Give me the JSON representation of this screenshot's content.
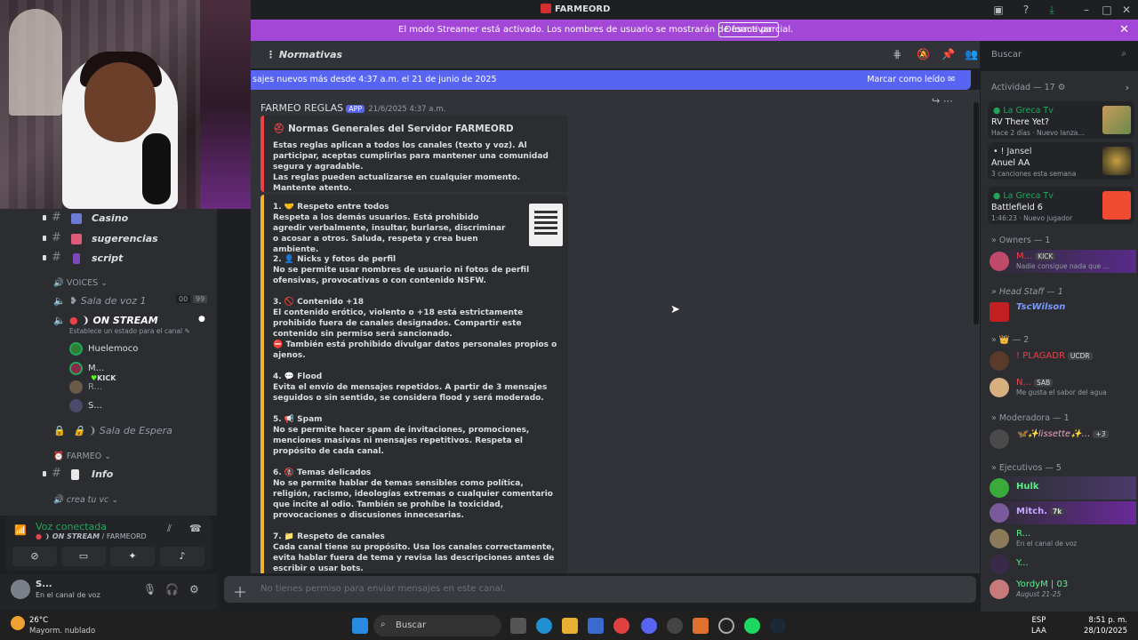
{
  "window": {
    "title": "FARMEORD"
  },
  "banner": {
    "message": "El modo Streamer está activado. Los nombres de usuario se mostrarán de forma parcial.",
    "button": "Desactivar"
  },
  "sidebar": {
    "channels": [
      {
        "name": "Casino"
      },
      {
        "name": "sugerencias"
      },
      {
        "name": "script"
      }
    ],
    "voices_category": "VOICES",
    "voice_channels": [
      {
        "name": "Sala de voz 1",
        "count_left": "00",
        "count_right": "99"
      },
      {
        "name": "ON STREAM",
        "status_hint": "Establece un estado para el canal"
      }
    ],
    "voice_users": [
      {
        "name": "Huelemoco"
      },
      {
        "name": "M...",
        "badge": "KICK"
      },
      {
        "name": "R..."
      },
      {
        "name": "S..."
      }
    ],
    "waiting_room": "Sala de Espera",
    "farmeo_category": "FARMEO",
    "info_channel": "Info",
    "crea_category": "crea tu vc"
  },
  "voice_panel": {
    "status": "Voz conectada",
    "location_channel": "ON STREAM",
    "location_server": "FARMEORD"
  },
  "user_panel": {
    "name": "S...",
    "status": "En el canal de voz"
  },
  "header": {
    "channel_name": "Normativas",
    "search_placeholder": "Buscar"
  },
  "new_messages": {
    "text": "sajes nuevos más desde 4:37 a.m. el 21 de junio de 2025",
    "action": "Marcar como leído"
  },
  "message": {
    "author": "FARMEO REGLAS",
    "app_tag": "APP",
    "timestamp": "21/6/2025 4:37 a.m.",
    "embed1_title": "Normas Generales del Servidor FARMEORD",
    "embed1_p1": "Estas reglas aplican a todos los canales (texto y voz). Al participar, aceptas cumplirlas para mantener una comunidad segura y agradable.",
    "embed1_p2": "Las reglas pueden actualizarse en cualquier momento. Mantente atento.",
    "rules": [
      {
        "title": "1. 🤝 Respeto entre todos",
        "body": "Respeta a los demás usuarios. Está prohibido agredir verbalmente, insultar, burlarse, discriminar o acosar a otros. Saluda, respeta y crea buen ambiente."
      },
      {
        "title": "2. 👤 Nicks y fotos de perfil",
        "body": "No se permite usar nombres de usuario ni fotos de perfil ofensivas, provocativas o con contenido NSFW."
      },
      {
        "title": "3. 🚫 Contenido +18",
        "body": "El contenido erótico, violento o +18 está estrictamente prohibido fuera de canales designados. Compartir este contenido sin permiso será sancionado.",
        "extra": "⛔ También está prohibido divulgar datos personales propios o ajenos."
      },
      {
        "title": "4. 💬 Flood",
        "body": "Evita el envío de mensajes repetidos. A partir de 3 mensajes seguidos o sin sentido, se considera flood y será moderado."
      },
      {
        "title": "5. 📢 Spam",
        "body": "No se permite hacer spam de invitaciones, promociones, menciones masivas ni mensajes repetitivos. Respeta el propósito de cada canal."
      },
      {
        "title": "6. 🚷 Temas delicados",
        "body": "No se permite hablar de temas sensibles como política, religión, racismo, ideologías extremas o cualquier comentario que incite al odio. También se prohíbe la toxicidad, provocaciones o discusiones innecesarias."
      },
      {
        "title": "7. 📁 Respeto de canales",
        "body": "Cada canal tiene su propósito. Usa los canales correctamente, evita hablar fuera de tema y revisa las descripciones antes de escribir o usar bots."
      }
    ]
  },
  "input": {
    "placeholder": "No tienes permiso para enviar mensajes en este canal."
  },
  "members": {
    "activity_header": "Actividad — 17",
    "activities": [
      {
        "user": "La Greca Tv",
        "title": "RV There Yet?",
        "meta": "Hace 2 días · Nuevo lanza..."
      },
      {
        "user": "! Jansel",
        "title": "Anuel AA",
        "meta": "3 canciones esta semana"
      },
      {
        "user": "La Greca Tv",
        "title": "Battlefield 6",
        "meta": "1:46:23 · Nuevo jugador"
      }
    ],
    "groups": [
      {
        "header": "Owners — 1",
        "members": [
          {
            "name": "M...",
            "tag": "KICK",
            "sub": "Nadie consigue nada que ..."
          }
        ]
      },
      {
        "header": "Head Staff — 1",
        "members": [
          {
            "name": "TscWilson",
            "sub": ""
          }
        ]
      },
      {
        "header": "— 2",
        "members": [
          {
            "name": "! PLAGADR",
            "tag": "UCDR",
            "sub": ""
          },
          {
            "name": "N...",
            "tag": "SAB",
            "sub": "Me gusta el sabor del agua"
          }
        ]
      },
      {
        "header": "Moderadora — 1",
        "members": [
          {
            "name": "lissette",
            "tag": "+3",
            "sub": ""
          }
        ]
      },
      {
        "header": "Ejecutivos — 5",
        "members": [
          {
            "name": "Hulk",
            "sub": ""
          },
          {
            "name": "Mitch.",
            "tag": "7k",
            "sub": ""
          },
          {
            "name": "R...",
            "sub": "En el canal de voz"
          },
          {
            "name": "Y...",
            "sub": ""
          },
          {
            "name": "YordyM | 03",
            "sub": "August 21-25"
          }
        ]
      }
    ]
  },
  "taskbar": {
    "weather_temp": "26°C",
    "weather_desc": "Mayorm. nublado",
    "search": "Buscar",
    "lang1": "ESP",
    "lang2": "LAA",
    "time": "8:51 p. m.",
    "date": "28/10/2025"
  },
  "colors": {
    "accent": "#5865f2",
    "banner": "#a348d6",
    "embed1_border": "#ed4245",
    "embed2_border": "#f0b232",
    "online": "#23a55a"
  }
}
